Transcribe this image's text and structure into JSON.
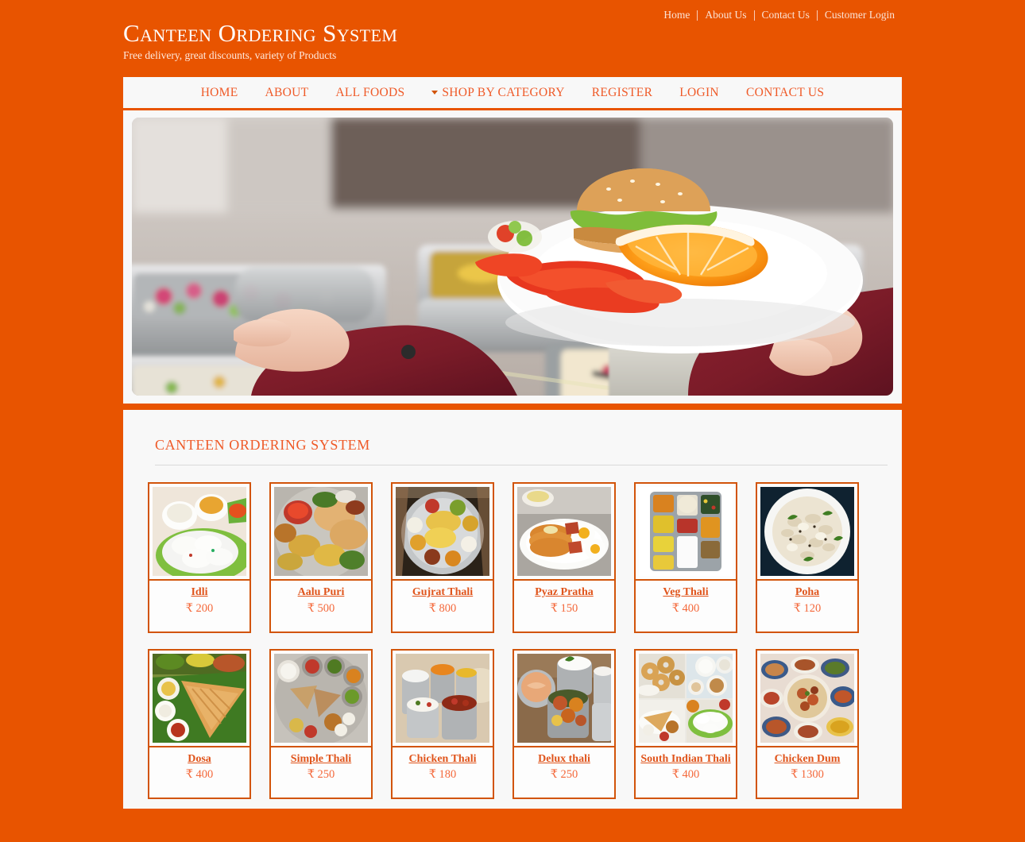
{
  "colors": {
    "background": "#e85400",
    "panel": "#f8f8f8",
    "accent": "#ef5a28",
    "card_border": "#d2540a",
    "name_text": "#e0541b",
    "price_text": "#f4683a",
    "rule": "#d9d9d9"
  },
  "header": {
    "title": "Canteen Ordering System",
    "tagline": "Free delivery, great discounts, variety of Products",
    "top_links": [
      {
        "label": "Home"
      },
      {
        "label": "About Us"
      },
      {
        "label": "Contact Us"
      },
      {
        "label": "Customer Login"
      }
    ]
  },
  "nav": {
    "items": [
      {
        "label": "HOME",
        "caret": false
      },
      {
        "label": "ABOUT",
        "caret": false
      },
      {
        "label": "ALL FOODS",
        "caret": false
      },
      {
        "label": "SHOP BY CATEGORY",
        "caret": true
      },
      {
        "label": "REGISTER",
        "caret": false
      },
      {
        "label": "LOGIN",
        "caret": false
      },
      {
        "label": "CONTACT US",
        "caret": false
      }
    ]
  },
  "hero": {
    "alt": "Cafeteria buffet counter with steam trays and a person in a maroon jacket holding a plate with a burger, orange slice and red peppers over a weighing scale"
  },
  "main": {
    "section_title": "CANTEEN ORDERING SYSTEM",
    "products": [
      {
        "name": "Idli",
        "price": "₹ 200",
        "image": "idli"
      },
      {
        "name": "Aalu Puri",
        "price": "₹ 500",
        "image": "aalu-puri"
      },
      {
        "name": "Gujrat Thali",
        "price": "₹ 800",
        "image": "gujrat-thali"
      },
      {
        "name": "Pyaz Pratha",
        "price": "₹ 150",
        "image": "pyaz-pratha"
      },
      {
        "name": "Veg Thali",
        "price": "₹ 400",
        "image": "veg-thali"
      },
      {
        "name": "Poha",
        "price": "₹ 120",
        "image": "poha"
      },
      {
        "name": "Dosa",
        "price": "₹ 400",
        "image": "dosa"
      },
      {
        "name": "Simple Thali",
        "price": "₹ 250",
        "image": "simple-thali"
      },
      {
        "name": "Chicken Thali",
        "price": "₹ 180",
        "image": "chicken-thali"
      },
      {
        "name": "Delux thali",
        "price": "₹ 250",
        "image": "delux-thali"
      },
      {
        "name": "South Indian Thali",
        "price": "₹ 400",
        "image": "south-indian-thali"
      },
      {
        "name": "Chicken Dum",
        "price": "₹ 1300",
        "image": "chicken-dum"
      }
    ]
  }
}
